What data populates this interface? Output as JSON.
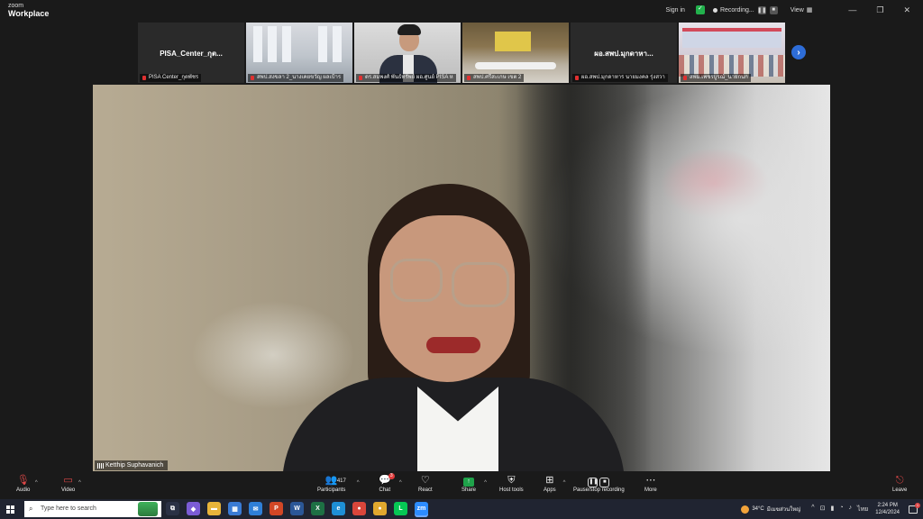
{
  "window": {
    "brand_small": "zoom",
    "brand_big": "Workplace",
    "sign_in": "Sign in",
    "recording_label": "Recording...",
    "view_label": "View",
    "controls": [
      "—",
      "❐",
      "✕"
    ]
  },
  "participants_strip": [
    {
      "kind": "name-card",
      "big_name": "PISA_Center_กุต...",
      "label": "PISA Center_กุตพัชร"
    },
    {
      "kind": "room",
      "label": "สพป.สงขลา 2_นางเคยขวัญ ผลเป้าร"
    },
    {
      "kind": "person",
      "label": "ดร.สมพงศ์ พันธ์ทรัพย์ ผอ.ศูนย์ PISA ห"
    },
    {
      "kind": "hall",
      "label": "สพป.ศรีสะเกษ เขต 2"
    },
    {
      "kind": "name-card",
      "big_name": "ผอ.สพป.มุกดาหา...",
      "label": "ผอ.สพป.มุกดาหาร นายมงคล รุ่งสวา"
    },
    {
      "kind": "conference",
      "label": "สพม.เพชรบูรณ์_นายกนก"
    }
  ],
  "main_video": {
    "speaker_name": "Ketthip Suphavanich"
  },
  "toolbar": {
    "audio": "Audio",
    "video": "Video",
    "participants": "Participants",
    "participants_count": "417",
    "chat": "Chat",
    "chat_badge": "3",
    "react": "React",
    "share": "Share",
    "host_tools": "Host tools",
    "apps": "Apps",
    "pause_stop_recording": "Pause/stop recording",
    "more": "More",
    "leave": "Leave"
  },
  "taskbar": {
    "search_placeholder": "Type here to search",
    "weather_temp": "34°C",
    "weather_text": "มีเมฆส่วนใหญ่",
    "language": "ไทย",
    "time": "2:24 PM",
    "date": "12/4/2024",
    "apps": [
      {
        "name": "task-view",
        "glyph": "⧉",
        "color": "#2b3145"
      },
      {
        "name": "copilot",
        "glyph": "◆",
        "color": "#7b5cd6"
      },
      {
        "name": "file-explorer",
        "glyph": "▬",
        "color": "#e8b43a"
      },
      {
        "name": "microsoft-store",
        "glyph": "▦",
        "color": "#3a7bd5"
      },
      {
        "name": "mail",
        "glyph": "✉",
        "color": "#2f7fd8"
      },
      {
        "name": "powerpoint",
        "glyph": "P",
        "color": "#d24726"
      },
      {
        "name": "word",
        "glyph": "W",
        "color": "#2b5797"
      },
      {
        "name": "excel",
        "glyph": "X",
        "color": "#1d7044"
      },
      {
        "name": "edge",
        "glyph": "e",
        "color": "#1e8fd6"
      },
      {
        "name": "chrome",
        "glyph": "●",
        "color": "#d9463b"
      },
      {
        "name": "chrome-2",
        "glyph": "●",
        "color": "#e0a82e"
      },
      {
        "name": "line",
        "glyph": "L",
        "color": "#06c755"
      },
      {
        "name": "zoom",
        "glyph": "zm",
        "color": "#2d8cff"
      }
    ]
  }
}
